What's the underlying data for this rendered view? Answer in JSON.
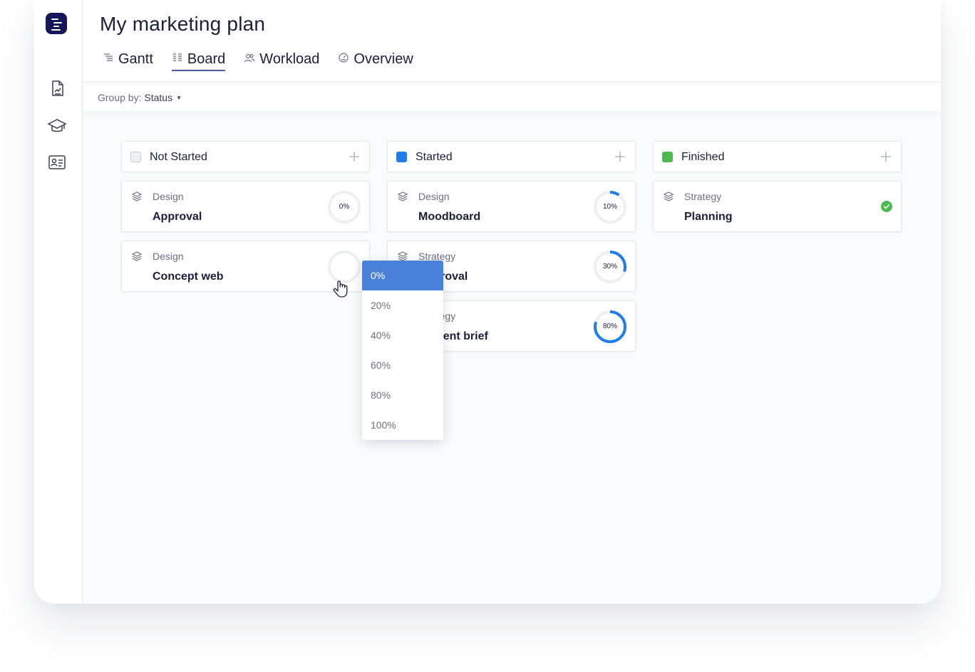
{
  "app": {
    "title": "My marketing plan",
    "tabs": [
      {
        "label": "Gantt",
        "icon": "gantt-icon",
        "active": false
      },
      {
        "label": "Board",
        "icon": "board-icon",
        "active": true
      },
      {
        "label": "Workload",
        "icon": "workload-users-icon",
        "active": false
      },
      {
        "label": "Overview",
        "icon": "overview-gauge-icon",
        "active": false
      }
    ]
  },
  "sidebar": {
    "logo_icon": "app-logo-icon",
    "items": [
      {
        "icon": "document-chart-icon"
      },
      {
        "icon": "graduation-cap-icon"
      },
      {
        "icon": "contact-card-icon"
      }
    ]
  },
  "toolbar": {
    "group_by_label": "Group by:",
    "group_by_value": "Status"
  },
  "colors": {
    "accent": "#4a5aa8",
    "started": "#1f7eea",
    "finished": "#4cbb4f",
    "not_started": "#e9ebf0",
    "progress": "#1f7eea",
    "selected_option": "#4a82db"
  },
  "columns": [
    {
      "title": "Not Started",
      "status_color": "#e9ebf0",
      "cards": [
        {
          "category": "Design",
          "name": "Approval",
          "progress": 0,
          "progress_label": "0%"
        },
        {
          "category": "Design",
          "name": "Concept web",
          "progress": 0,
          "progress_label": ""
        }
      ]
    },
    {
      "title": "Started",
      "status_color": "#1f7eea",
      "cards": [
        {
          "category": "Design",
          "name": "Moodboard",
          "progress": 10,
          "progress_label": "10%"
        },
        {
          "category": "Strategy",
          "name": "Approval",
          "progress": 30,
          "progress_label": "30%"
        },
        {
          "category": "Strategy",
          "name": "Present brief",
          "progress": 80,
          "progress_label": "80%"
        }
      ]
    },
    {
      "title": "Finished",
      "status_color": "#4cbb4f",
      "cards": [
        {
          "category": "Strategy",
          "name": "Planning",
          "progress": 100,
          "completed": true
        }
      ]
    }
  ],
  "progress_dropdown": {
    "selected": "0%",
    "options": [
      "0%",
      "20%",
      "40%",
      "60%",
      "80%",
      "100%"
    ]
  }
}
